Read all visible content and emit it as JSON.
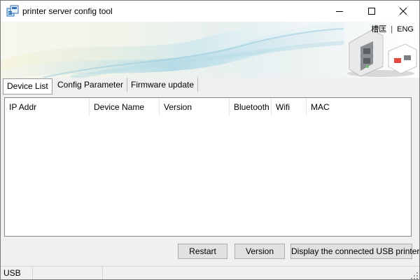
{
  "window": {
    "title": "printer server config tool",
    "icons": {
      "app": "printer-server-icon",
      "minimize": "minimize-icon",
      "maximize": "maximize-icon",
      "close": "close-icon"
    }
  },
  "banner": {
    "lang_cn": "槽匡",
    "lang_sep": "|",
    "lang_en": "ENG",
    "image": "print-server-device-illustration"
  },
  "tabs": [
    {
      "label": "Device List",
      "active": true
    },
    {
      "label": "Config Parameter",
      "active": false
    },
    {
      "label": "Firmware update",
      "active": false
    }
  ],
  "device_list": {
    "columns": [
      "IP Addr",
      "Device Name",
      "Version",
      "Bluetooth",
      "Wifi",
      "MAC"
    ],
    "rows": []
  },
  "buttons": {
    "restart": "Restart",
    "version": "Version",
    "display_usb": "Display the connected USB printer"
  },
  "statusbar": {
    "connection": "USB"
  },
  "colors": {
    "window_bg": "#f0f0f0",
    "banner_swirl": "#bfe0ea"
  }
}
